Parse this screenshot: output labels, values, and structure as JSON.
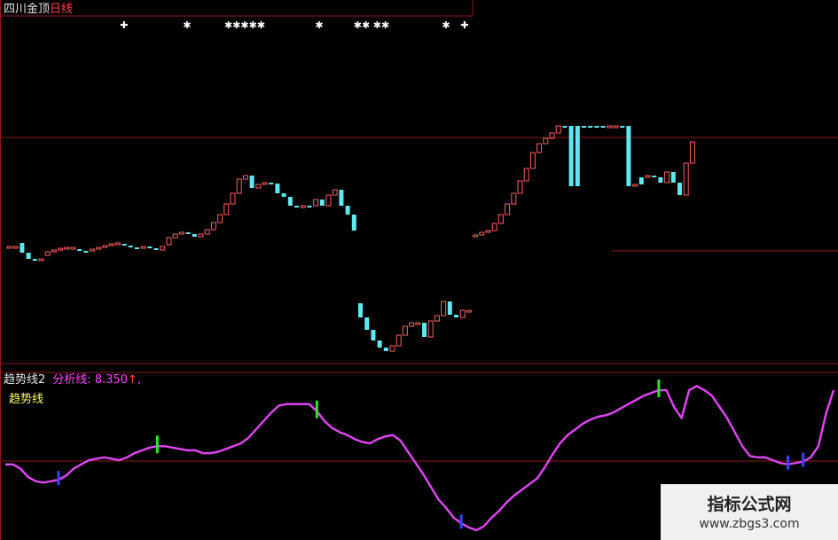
{
  "main_panel": {
    "title": "四川金顶",
    "period": "日线"
  },
  "indicator_panel": {
    "name": "趋势线2",
    "label": "分析线:",
    "value": "8.350",
    "arrow": "↑",
    "comma": ",",
    "line_label": "趋势线"
  },
  "watermark": {
    "brand": "指标公式网",
    "site": "www.zbgs3.com"
  },
  "colors": {
    "background": "#000000",
    "up_candle": "#ff6060",
    "down_candle": "#60e8f0",
    "trend_line": "#dd44ee",
    "green_mark": "#33dd33",
    "blue_mark": "#3344ff",
    "divider": "#8b1a1a"
  },
  "chart_data": [
    {
      "type": "candlestick",
      "signals": [
        "✚",
        "✱",
        "✱✱✱✱✱",
        "✱",
        "✱✱",
        "✱✱",
        "✱",
        "✚"
      ],
      "candles": [
        {
          "o": 2,
          "c": 2,
          "d": "u"
        },
        {
          "o": 2,
          "c": 1,
          "d": "u"
        },
        {
          "o": 6,
          "c": -5,
          "d": "d"
        },
        {
          "o": -5,
          "c": -12,
          "d": "d"
        },
        {
          "o": -12,
          "c": -14,
          "d": "d"
        },
        {
          "o": -14,
          "c": -12,
          "d": "u"
        },
        {
          "o": -8,
          "c": -4,
          "d": "u"
        },
        {
          "o": -4,
          "c": -2,
          "d": "u"
        },
        {
          "o": -2,
          "c": 0,
          "d": "u"
        },
        {
          "o": 0,
          "c": 1,
          "d": "u"
        },
        {
          "o": 1,
          "c": -1,
          "d": "u"
        },
        {
          "o": -1,
          "c": -3,
          "d": "d"
        },
        {
          "o": -3,
          "c": -4,
          "d": "d"
        },
        {
          "o": -3,
          "c": -1,
          "d": "u"
        },
        {
          "o": -1,
          "c": 1,
          "d": "u"
        },
        {
          "o": 1,
          "c": 3,
          "d": "u"
        },
        {
          "o": 3,
          "c": 5,
          "d": "u"
        },
        {
          "o": 5,
          "c": 6,
          "d": "u"
        },
        {
          "o": 5,
          "c": 3,
          "d": "d"
        },
        {
          "o": 3,
          "c": 1,
          "d": "d"
        },
        {
          "o": 1,
          "c": 0,
          "d": "d"
        },
        {
          "o": 0,
          "c": 2,
          "d": "u"
        },
        {
          "o": 2,
          "c": 0,
          "d": "d"
        },
        {
          "o": 0,
          "c": -2,
          "d": "d"
        },
        {
          "o": -2,
          "c": 2,
          "d": "u"
        },
        {
          "o": 4,
          "c": 12,
          "d": "u"
        },
        {
          "o": 12,
          "c": 16,
          "d": "u"
        },
        {
          "o": 16,
          "c": 18,
          "d": "u"
        },
        {
          "o": 18,
          "c": 16,
          "d": "d"
        },
        {
          "o": 16,
          "c": 13,
          "d": "d"
        },
        {
          "o": 13,
          "c": 16,
          "d": "u"
        },
        {
          "o": 16,
          "c": 21,
          "d": "u"
        },
        {
          "o": 21,
          "c": 29,
          "d": "u"
        },
        {
          "o": 29,
          "c": 38,
          "d": "u"
        },
        {
          "o": 38,
          "c": 50,
          "d": "u"
        },
        {
          "o": 50,
          "c": 62,
          "d": "u"
        },
        {
          "o": 62,
          "c": 78,
          "d": "u"
        },
        {
          "o": 78,
          "c": 82,
          "d": "u"
        },
        {
          "o": 82,
          "c": 68,
          "d": "d"
        },
        {
          "o": 68,
          "c": 72,
          "d": "u"
        },
        {
          "o": 72,
          "c": 74,
          "d": "u"
        },
        {
          "o": 74,
          "c": 73,
          "d": "d"
        },
        {
          "o": 73,
          "c": 62,
          "d": "d"
        },
        {
          "o": 62,
          "c": 58,
          "d": "d"
        },
        {
          "o": 58,
          "c": 48,
          "d": "d"
        },
        {
          "o": 48,
          "c": 46,
          "d": "d"
        },
        {
          "o": 46,
          "c": 48,
          "d": "u"
        },
        {
          "o": 48,
          "c": 48,
          "d": "d"
        },
        {
          "o": 48,
          "c": 55,
          "d": "u"
        },
        {
          "o": 55,
          "c": 48,
          "d": "d"
        },
        {
          "o": 48,
          "c": 60,
          "d": "u"
        },
        {
          "o": 60,
          "c": 66,
          "d": "u"
        },
        {
          "o": 66,
          "c": 48,
          "d": "d"
        },
        {
          "o": 48,
          "c": 38,
          "d": "d"
        },
        {
          "o": 38,
          "c": 20,
          "d": "d"
        },
        {
          "o": -62,
          "c": -78,
          "d": "d"
        },
        {
          "o": -78,
          "c": -92,
          "d": "d"
        },
        {
          "o": -92,
          "c": -104,
          "d": "d"
        },
        {
          "o": -104,
          "c": -112,
          "d": "d"
        },
        {
          "o": -112,
          "c": -116,
          "d": "d"
        },
        {
          "o": -116,
          "c": -110,
          "d": "u"
        },
        {
          "o": -110,
          "c": -98,
          "d": "u"
        },
        {
          "o": -98,
          "c": -88,
          "d": "u"
        },
        {
          "o": -88,
          "c": -84,
          "d": "u"
        },
        {
          "o": -84,
          "c": -84,
          "d": "u"
        },
        {
          "o": -84,
          "c": -100,
          "d": "d"
        },
        {
          "o": -100,
          "c": -82,
          "d": "u"
        },
        {
          "o": -82,
          "c": -76,
          "d": "u"
        },
        {
          "o": -76,
          "c": -60,
          "d": "u"
        },
        {
          "o": -60,
          "c": -75,
          "d": "d"
        },
        {
          "o": -75,
          "c": -78,
          "d": "d"
        },
        {
          "o": -78,
          "c": -70,
          "d": "u"
        },
        {
          "o": -70,
          "c": -70,
          "d": "u"
        },
        {
          "o": 13,
          "c": 15,
          "d": "u"
        },
        {
          "o": 15,
          "c": 18,
          "d": "u"
        },
        {
          "o": 18,
          "c": 20,
          "d": "u"
        },
        {
          "o": 20,
          "c": 28,
          "d": "u"
        },
        {
          "o": 28,
          "c": 38,
          "d": "u"
        },
        {
          "o": 38,
          "c": 50,
          "d": "u"
        },
        {
          "o": 50,
          "c": 62,
          "d": "u"
        },
        {
          "o": 62,
          "c": 76,
          "d": "u"
        },
        {
          "o": 76,
          "c": 90,
          "d": "u"
        },
        {
          "o": 90,
          "c": 108,
          "d": "u"
        },
        {
          "o": 108,
          "c": 118,
          "d": "u"
        },
        {
          "o": 118,
          "c": 124,
          "d": "u"
        },
        {
          "o": 124,
          "c": 130,
          "d": "u"
        },
        {
          "o": 130,
          "c": 138,
          "d": "u"
        },
        {
          "o": 138,
          "c": 136,
          "d": "d"
        },
        {
          "o": 138,
          "c": 70,
          "d": "d"
        },
        {
          "o": 138,
          "c": 70,
          "d": "d"
        },
        {
          "o": 138,
          "c": 138,
          "d": "d"
        },
        {
          "o": 138,
          "c": 138,
          "d": "d"
        },
        {
          "o": 138,
          "c": 138,
          "d": "d"
        },
        {
          "o": 138,
          "c": 138,
          "d": "d"
        },
        {
          "o": 138,
          "c": 138,
          "d": "u"
        },
        {
          "o": 138,
          "c": 138,
          "d": "u"
        },
        {
          "o": 138,
          "c": 138,
          "d": "d"
        },
        {
          "o": 138,
          "c": 70,
          "d": "d"
        },
        {
          "o": 70,
          "c": 72,
          "d": "u"
        },
        {
          "o": 72,
          "c": 80,
          "d": "d"
        },
        {
          "o": 80,
          "c": 82,
          "d": "u"
        },
        {
          "o": 82,
          "c": 80,
          "d": "d"
        },
        {
          "o": 80,
          "c": 74,
          "d": "d"
        },
        {
          "o": 74,
          "c": 86,
          "d": "u"
        },
        {
          "o": 86,
          "c": 74,
          "d": "d"
        },
        {
          "o": 74,
          "c": 60,
          "d": "d"
        },
        {
          "o": 60,
          "c": 96,
          "d": "u"
        },
        {
          "o": 96,
          "c": 120,
          "d": "u"
        }
      ]
    },
    {
      "type": "line",
      "series": [
        {
          "name": "趋势线",
          "values": [
            47,
            47,
            44,
            38,
            35,
            34,
            35,
            36,
            39,
            44,
            47,
            50,
            51,
            52,
            51,
            50,
            52,
            55,
            57,
            59,
            60,
            60,
            59,
            58,
            57,
            57,
            55,
            55,
            56,
            58,
            60,
            62,
            66,
            72,
            78,
            84,
            89,
            90,
            90,
            90,
            90,
            85,
            78,
            73,
            70,
            68,
            65,
            63,
            62,
            65,
            67,
            68,
            64,
            56,
            48,
            40,
            31,
            22,
            16,
            9,
            5,
            2,
            0,
            3,
            9,
            14,
            20,
            25,
            29,
            33,
            37,
            45,
            54,
            62,
            68,
            72,
            76,
            79,
            81,
            82,
            84,
            87,
            90,
            93,
            96,
            98,
            100,
            100,
            88,
            80,
            100,
            103,
            100,
            96,
            88,
            80,
            70,
            60,
            53,
            52,
            52,
            50,
            48,
            47,
            48,
            49,
            52,
            60,
            83,
            100
          ]
        }
      ],
      "green_marks": [
        20,
        41,
        86
      ],
      "blue_marks": [
        7,
        60,
        103,
        105
      ]
    }
  ]
}
